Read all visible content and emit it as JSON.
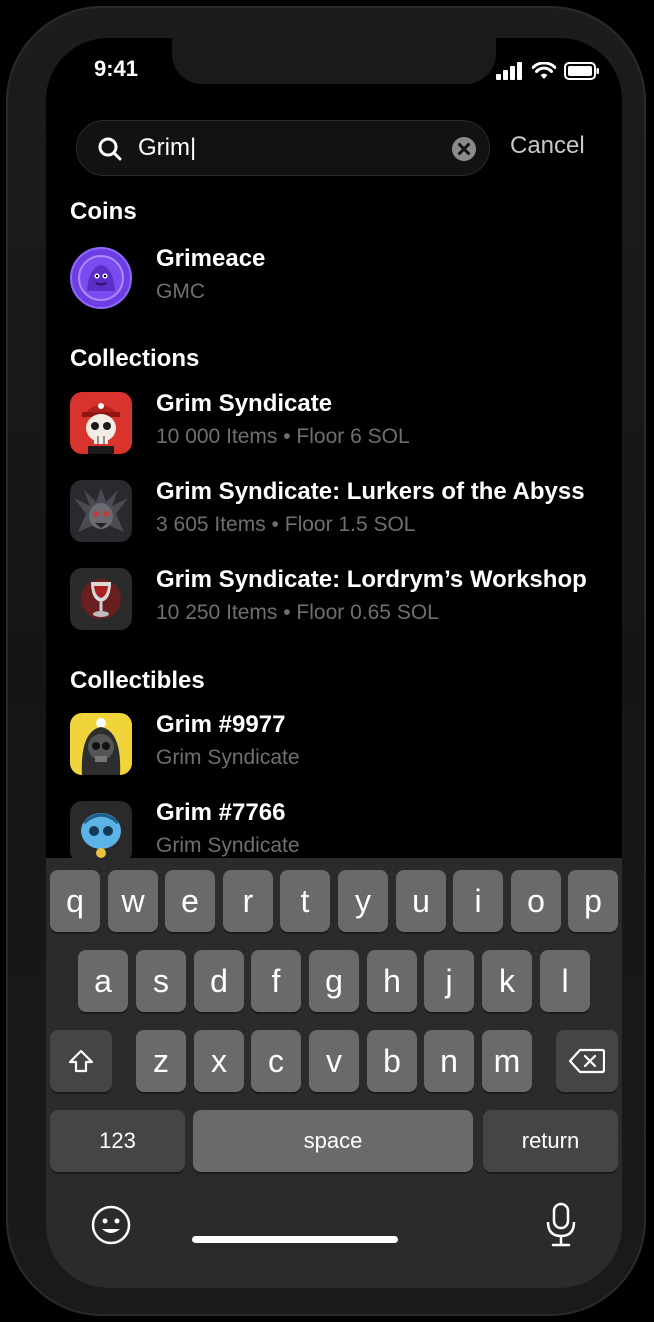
{
  "status": {
    "time": "9:41"
  },
  "search": {
    "query": "Grim|",
    "cancel_label": "Cancel"
  },
  "sections": {
    "coins": "Coins",
    "collections": "Collections",
    "collectibles": "Collectibles"
  },
  "coins": [
    {
      "title": "Grimeace",
      "subtitle": "GMC"
    }
  ],
  "collections": [
    {
      "title": "Grim Syndicate",
      "subtitle": "10 000 Items • Floor 6 SOL"
    },
    {
      "title": "Grim Syndicate: Lurkers of the Abyss",
      "subtitle": "3 605 Items • Floor 1.5 SOL"
    },
    {
      "title": "Grim Syndicate: Lordrym’s Workshop",
      "subtitle": "10 250 Items • Floor 0.65 SOL"
    }
  ],
  "collectibles": [
    {
      "title": "Grim #9977",
      "subtitle": "Grim Syndicate"
    },
    {
      "title": "Grim #7766",
      "subtitle": "Grim Syndicate"
    }
  ],
  "keyboard": {
    "row1": [
      "q",
      "w",
      "e",
      "r",
      "t",
      "y",
      "u",
      "i",
      "o",
      "p"
    ],
    "row2": [
      "a",
      "s",
      "d",
      "f",
      "g",
      "h",
      "j",
      "k",
      "l"
    ],
    "row3": [
      "z",
      "x",
      "c",
      "v",
      "b",
      "n",
      "m"
    ],
    "numbers_label": "123",
    "space_label": "space",
    "return_label": "return"
  },
  "colors": {
    "accent_purple": "#6d3fe3",
    "background": "#000000",
    "keyboard": "#2b2b2b"
  }
}
